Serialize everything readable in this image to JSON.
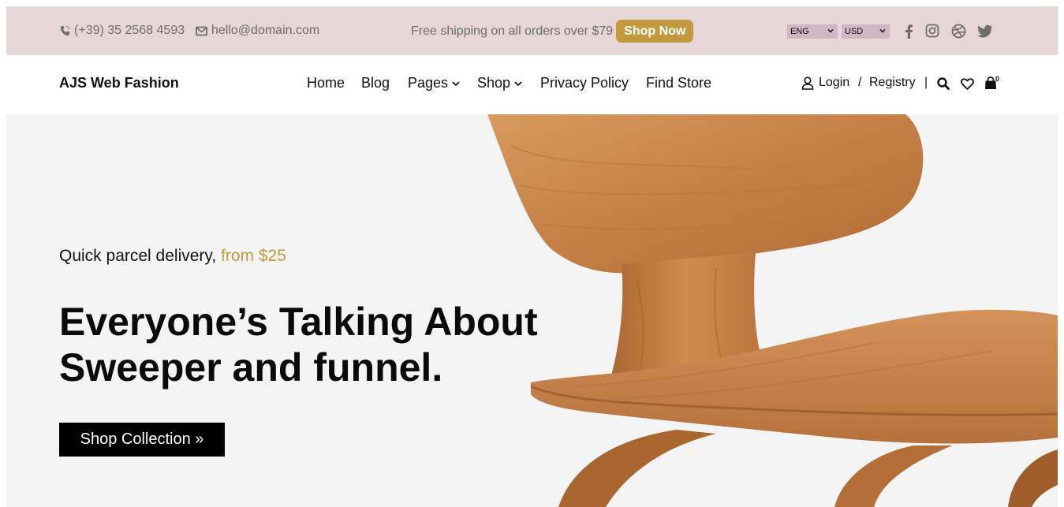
{
  "topbar": {
    "phone": "(+39) 35 2568 4593",
    "email": "hello@domain.com",
    "promo_text": "Free shipping on all orders over $79",
    "promo_button": "Shop Now",
    "language": "ENG",
    "currency": "USD",
    "social_icons": [
      "facebook-icon",
      "instagram-icon",
      "dribbble-icon",
      "twitter-icon"
    ]
  },
  "header": {
    "logo": "AJS Web Fashion",
    "nav": [
      {
        "label": "Home"
      },
      {
        "label": "Blog"
      },
      {
        "label": "Pages"
      },
      {
        "label": "Shop"
      },
      {
        "label": "Privacy Policy"
      },
      {
        "label": "Find Store"
      }
    ],
    "login": "Login",
    "separator": "/",
    "registry": "Registry",
    "divider": "|",
    "cart_count": "0"
  },
  "hero": {
    "subtitle": "Quick parcel delivery,",
    "subtitle_accent": "from $25",
    "title_line1": "Everyone’s Talking About",
    "title_line2": "Sweeper and funnel.",
    "button": "Shop Collection »"
  },
  "colors": {
    "topbar_bg": "#e6d6d8",
    "accent": "#c19a3d",
    "hero_bg": "#f4f4f4",
    "button_bg": "#000000"
  }
}
